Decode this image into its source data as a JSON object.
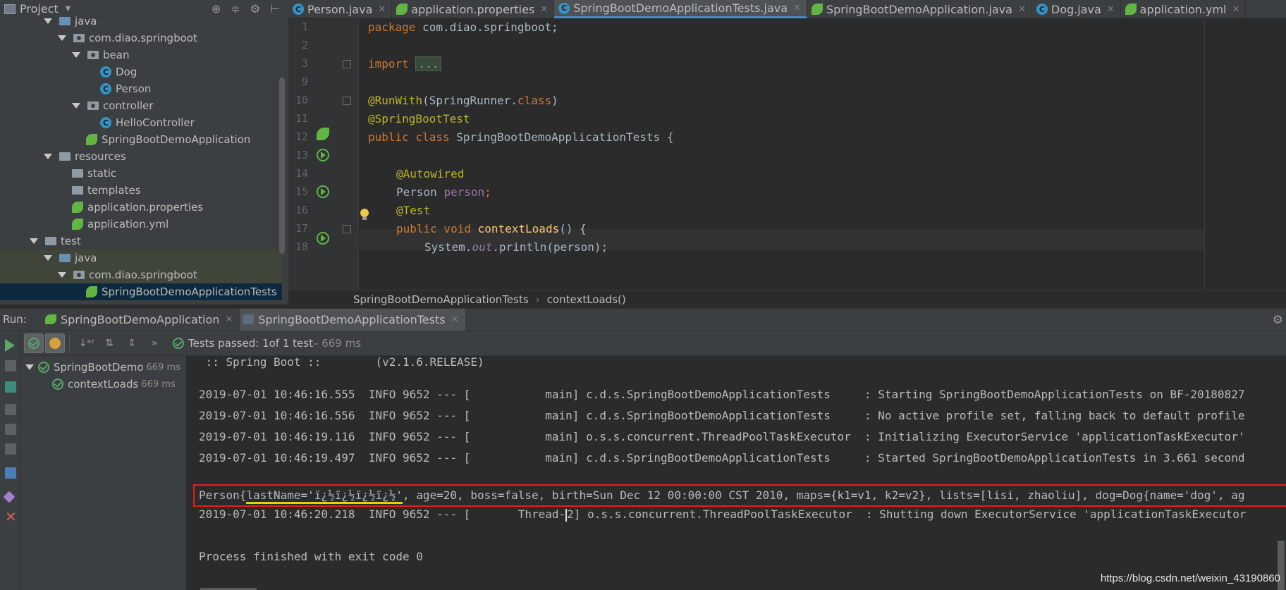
{
  "project": {
    "title": "Project",
    "tree": [
      {
        "label": "java",
        "kind": "folder-blue",
        "depth": 3,
        "arrow": true
      },
      {
        "label": "com.diao.springboot",
        "kind": "package",
        "depth": 4,
        "arrow": true
      },
      {
        "label": "bean",
        "kind": "package",
        "depth": 5,
        "arrow": true
      },
      {
        "label": "Dog",
        "kind": "class",
        "depth": 7,
        "arrow": false
      },
      {
        "label": "Person",
        "kind": "class",
        "depth": 7,
        "arrow": false
      },
      {
        "label": "controller",
        "kind": "package",
        "depth": 5,
        "arrow": true
      },
      {
        "label": "HelloController",
        "kind": "class",
        "depth": 7,
        "arrow": false
      },
      {
        "label": "SpringBootDemoApplication",
        "kind": "spring",
        "depth": 6,
        "arrow": false
      },
      {
        "label": "resources",
        "kind": "folder-res",
        "depth": 3,
        "arrow": true
      },
      {
        "label": "static",
        "kind": "folder",
        "depth": 5,
        "arrow": false
      },
      {
        "label": "templates",
        "kind": "folder",
        "depth": 5,
        "arrow": false
      },
      {
        "label": "application.properties",
        "kind": "spring",
        "depth": 5,
        "arrow": false
      },
      {
        "label": "application.yml",
        "kind": "spring",
        "depth": 5,
        "arrow": false
      },
      {
        "label": "test",
        "kind": "folder",
        "depth": 2,
        "arrow": true
      },
      {
        "label": "java",
        "kind": "folder-blue",
        "depth": 3,
        "arrow": true
      },
      {
        "label": "com.diao.springboot",
        "kind": "package",
        "depth": 4,
        "arrow": true
      },
      {
        "label": "SpringBootDemoApplicationTests",
        "kind": "spring",
        "depth": 6,
        "arrow": false
      }
    ]
  },
  "editor": {
    "tabs": [
      {
        "label": "Person.java",
        "icon": "class",
        "active": false
      },
      {
        "label": "application.properties",
        "icon": "spring",
        "active": false
      },
      {
        "label": "SpringBootDemoApplicationTests.java",
        "icon": "class",
        "active": true
      },
      {
        "label": "SpringBootDemoApplication.java",
        "icon": "spring",
        "active": false
      },
      {
        "label": "Dog.java",
        "icon": "class",
        "active": false
      },
      {
        "label": "application.yml",
        "icon": "spring",
        "active": false
      }
    ],
    "line_numbers": [
      "1",
      "2",
      "3",
      "9",
      "10",
      "11",
      "12",
      "13",
      "14",
      "15",
      "16",
      "17",
      "18"
    ],
    "code": {
      "l1_kw": "package",
      "l1_rest": " com.diao.springboot;",
      "l3_kw": "import",
      "l3_fold": "...",
      "l10_ann": "@RunWith",
      "l10_a": "(SpringRunner.",
      "l10_kw": "class",
      "l10_b": ")",
      "l11_ann": "@SpringBootTest",
      "l12_kw": "public class",
      "l12_rest": " SpringBootDemoApplicationTests {",
      "l14_ann": "@Autowired",
      "l15_type": "Person ",
      "l15_fld": "person",
      "l15_end": ";",
      "l16_ann": "@Test",
      "l17_kw": "public void",
      "l17_fn": "contextLoads",
      "l17_rest": "() {",
      "l18_a": "System.",
      "l18_fld": "out",
      "l18_b": ".println(person);"
    },
    "breadcrumb": [
      "SpringBootDemoApplicationTests",
      "contextLoads()"
    ]
  },
  "run": {
    "label": "Run:",
    "tabs": [
      {
        "label": "SpringBootDemoApplication",
        "active": false
      },
      {
        "label": "SpringBootDemoApplicationTests",
        "active": true
      }
    ],
    "status_prefix": "Tests passed: ",
    "status_count": "1",
    "status_mid": " of 1 test",
    "status_time": " – 669 ms",
    "tree": [
      {
        "label": "SpringBootDemo",
        "time": "669 ms"
      },
      {
        "label": "contextLoads",
        "time": "669 ms"
      }
    ]
  },
  "console": {
    "banner": " :: Spring Boot ::        (v2.1.6.RELEASE)",
    "lines": [
      "2019-07-01 10:46:16.555  INFO 9652 --- [           main] c.d.s.SpringBootDemoApplicationTests     : Starting SpringBootDemoApplicationTests on BF-20180827",
      "2019-07-01 10:46:16.556  INFO 9652 --- [           main] c.d.s.SpringBootDemoApplicationTests     : No active profile set, falling back to default profile",
      "2019-07-01 10:46:19.116  INFO 9652 --- [           main] o.s.s.concurrent.ThreadPoolTaskExecutor  : Initializing ExecutorService 'applicationTaskExecutor'",
      "2019-07-01 10:46:19.497  INFO 9652 --- [           main] c.d.s.SpringBootDemoApplicationTests     : Started SpringBootDemoApplicationTests in 3.661 second"
    ],
    "person_prefix": "Person{",
    "person_lastname": "lastName='ï¿½ï¿½ï¿½ï¿½'",
    "person_rest": ", age=20, boss=false, birth=Sun Dec 12 00:00:00 CST 2010, maps={k1=v1, k2=v2}, lists=[lisi, zhaoliu], dog=Dog{name='dog', ag",
    "shutdown_a": "2019-07-01 10:46:20.218  INFO 9652 --- [       Thread-",
    "shutdown_b": "2] o.s.s.concurrent.ThreadPoolTaskExecutor  : Shutting down ExecutorService 'applicationTaskExecutor",
    "exit": "Process finished with exit code 0"
  },
  "watermark": "https://blog.csdn.net/weixin_43190860",
  "colors": {
    "keyword": "#cc7832",
    "annotation": "#bbb529",
    "method": "#ffc66d",
    "field": "#9876aa",
    "highlight_box": "#e02020",
    "underline": "#e8d300"
  }
}
